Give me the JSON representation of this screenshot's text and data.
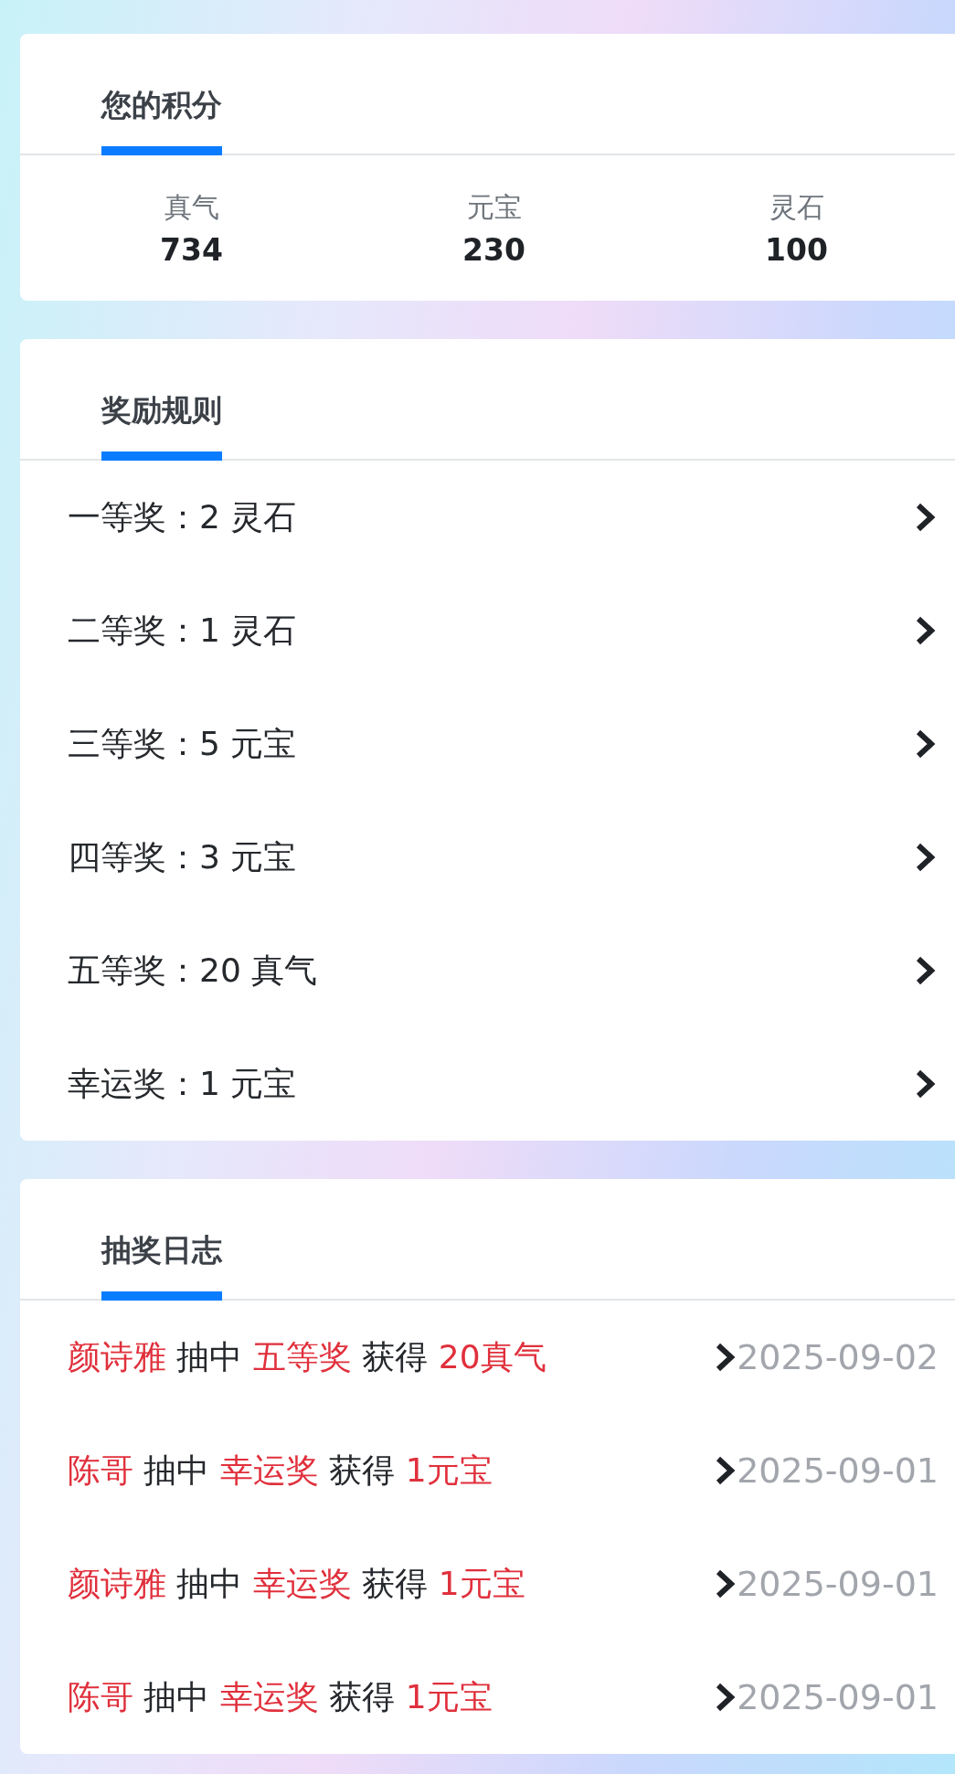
{
  "points_card": {
    "tab": {
      "label": "您的积分",
      "selected": true
    },
    "stats": [
      {
        "label": "真气",
        "value": "734"
      },
      {
        "label": "元宝",
        "value": "230"
      },
      {
        "label": "灵石",
        "value": "100"
      }
    ]
  },
  "rules_card": {
    "tab": {
      "label": "奖励规则",
      "selected": true
    },
    "rules": [
      {
        "text": "一等奖：2 灵石"
      },
      {
        "text": "二等奖：1 灵石"
      },
      {
        "text": "三等奖：5 元宝"
      },
      {
        "text": "四等奖：3 元宝"
      },
      {
        "text": "五等奖：20 真气"
      },
      {
        "text": "幸运奖：1 元宝"
      }
    ]
  },
  "log_card": {
    "tab": {
      "label": "抽奖日志",
      "selected": true
    },
    "entries": [
      {
        "name": "颜诗雅",
        "verb": "抽中",
        "prize": "五等奖",
        "gain": "获得",
        "reward": "20真气",
        "date": "2025-09-02"
      },
      {
        "name": "陈哥",
        "verb": "抽中",
        "prize": "幸运奖",
        "gain": "获得",
        "reward": "1元宝",
        "date": "2025-09-01"
      },
      {
        "name": "颜诗雅",
        "verb": "抽中",
        "prize": "幸运奖",
        "gain": "获得",
        "reward": "1元宝",
        "date": "2025-09-01"
      },
      {
        "name": "陈哥",
        "verb": "抽中",
        "prize": "幸运奖",
        "gain": "获得",
        "reward": "1元宝",
        "date": "2025-09-01"
      }
    ]
  }
}
